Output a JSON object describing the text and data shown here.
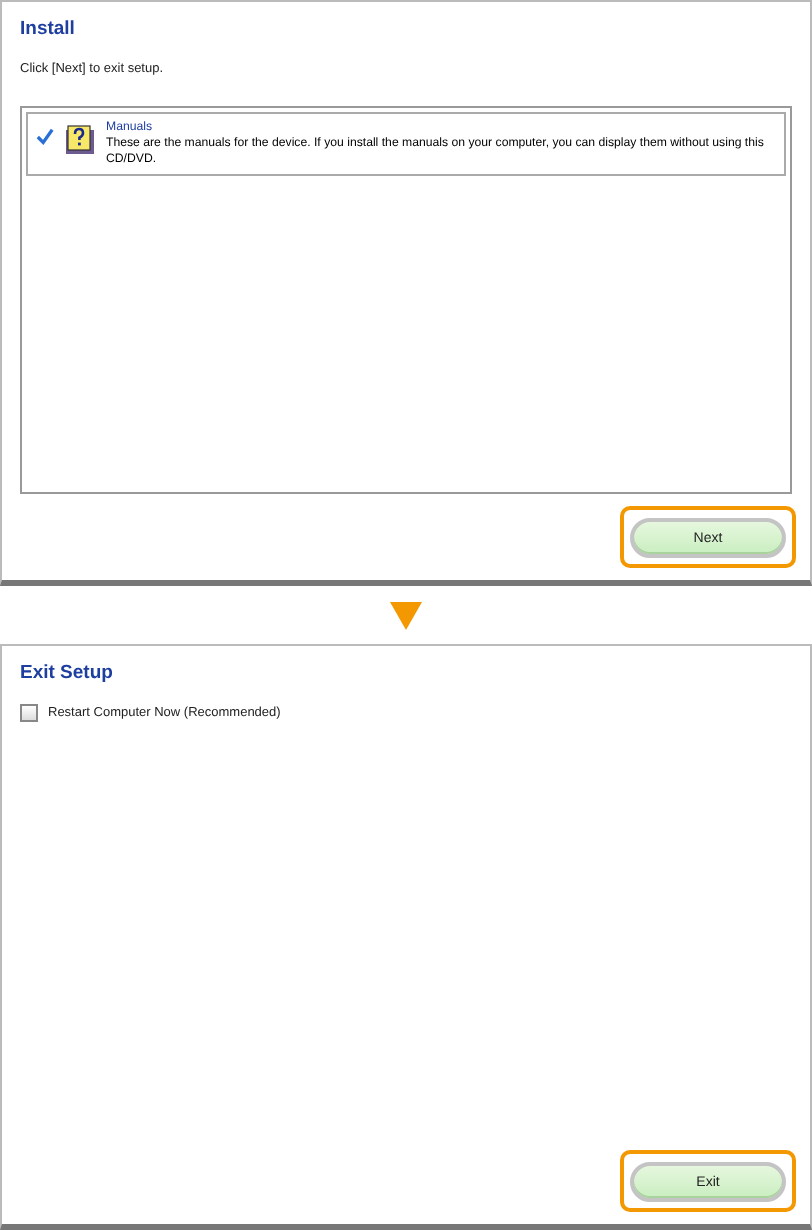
{
  "panels": [
    {
      "title": "Install",
      "instruction": "Click [Next] to exit setup.",
      "items": [
        {
          "name": "Manuals",
          "description": "These are the manuals for the device. If you install the manuals on your computer, you can display them without using this CD/DVD.",
          "checked": true
        }
      ],
      "button": {
        "label": "Next",
        "highlighted": true
      }
    },
    {
      "title": "Exit Setup",
      "options": [
        {
          "label": "Restart Computer Now (Recommended)",
          "checked": false
        }
      ],
      "button": {
        "label": "Exit",
        "highlighted": true
      }
    }
  ]
}
